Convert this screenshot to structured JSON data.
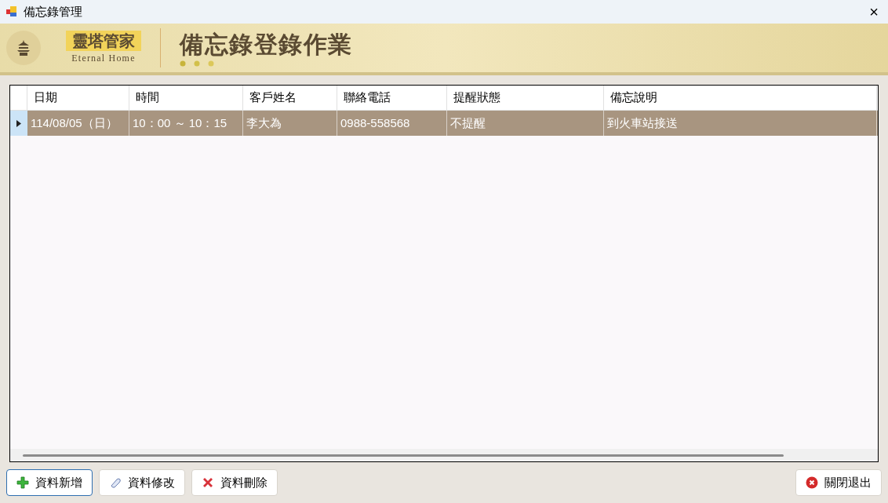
{
  "window": {
    "title": "備忘錄管理",
    "close": "×"
  },
  "banner": {
    "brand_name": "靈塔管家",
    "brand_subtitle": "Eternal Home",
    "title": "備忘錄登錄作業"
  },
  "table": {
    "columns": [
      "日期",
      "時間",
      "客戶姓名",
      "聯絡電話",
      "提醒狀態",
      "備忘說明"
    ],
    "rows": [
      {
        "cells": [
          "114/08/05（日）",
          "10：00 ～ 10：15",
          "李大為",
          "0988-558568",
          "不提醒",
          "到火車站接送"
        ],
        "selected": true
      }
    ]
  },
  "buttons": [
    {
      "kind": "add",
      "label": "資料新增",
      "focused": true
    },
    {
      "kind": "edit",
      "label": "資料修改",
      "focused": false
    },
    {
      "kind": "delete",
      "label": "資料刪除",
      "focused": false
    },
    {
      "kind": "close",
      "label": "關閉退出",
      "focused": false
    }
  ]
}
